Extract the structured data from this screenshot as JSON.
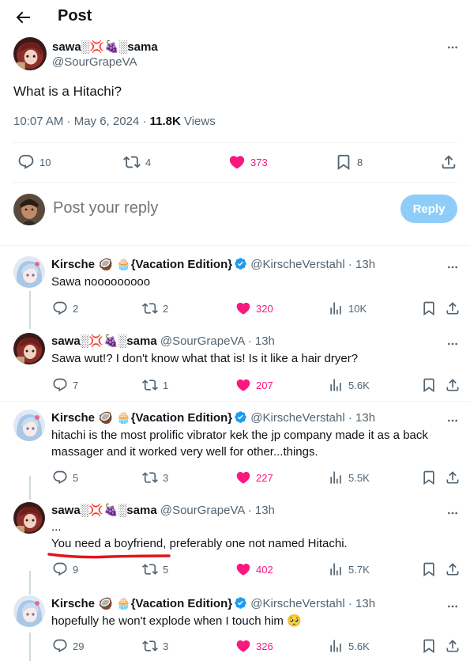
{
  "header": {
    "title": "Post"
  },
  "post": {
    "name": "sawa░💢🍇░sama",
    "handle": "@SourGrapeVA",
    "text": "What is a Hitachi?",
    "time": "10:07 AM · May 6, 2024 · ",
    "views_count": "11.8K",
    "views_label": " Views",
    "stats": {
      "replies": "10",
      "reposts": "4",
      "likes": "373",
      "bookmarks": "8"
    }
  },
  "reply_box": {
    "placeholder": "Post your reply",
    "button": "Reply"
  },
  "replies": [
    {
      "name": "Kirsche 🥥 🧁{Vacation Edition}",
      "handle": "@KirscheVerstahl",
      "time": "· 13h",
      "text": "Sawa nooooooooo",
      "stats": {
        "replies": "2",
        "reposts": "2",
        "likes": "320",
        "views": "10K"
      }
    },
    {
      "name": "sawa░💢🍇░sama",
      "handle": "@SourGrapeVA",
      "time": "· 13h",
      "text": "Sawa wut!? I don't know what that is! Is it like a hair dryer?",
      "stats": {
        "replies": "7",
        "reposts": "1",
        "likes": "207",
        "views": "5.6K"
      }
    },
    {
      "name": "Kirsche 🥥 🧁{Vacation Edition}",
      "handle": "@KirscheVerstahl",
      "time": "· 13h",
      "text": "hitachi is the most prolific vibrator kek the jp company made it as a back massager and it worked very well for other...things.",
      "stats": {
        "replies": "5",
        "reposts": "3",
        "likes": "227",
        "views": "5.5K"
      }
    },
    {
      "name": "sawa░💢🍇░sama",
      "handle": "@SourGrapeVA",
      "time": "· 13h",
      "text_line1": "...",
      "text": "You need a boyfriend, preferably one not named Hitachi.",
      "stats": {
        "replies": "9",
        "reposts": "5",
        "likes": "402",
        "views": "5.7K"
      }
    },
    {
      "name": "Kirsche 🥥 🧁{Vacation Edition}",
      "handle": "@KirscheVerstahl",
      "time": "· 13h",
      "text": "hopefully he won't explode when I touch him 🥺",
      "stats": {
        "replies": "29",
        "reposts": "3",
        "likes": "326",
        "views": "5.6K"
      }
    }
  ],
  "colors": {
    "accent": "#1d9bf0",
    "like": "#f91880",
    "reply_button": "#8ecdf8",
    "annotation": "#e0161b"
  }
}
